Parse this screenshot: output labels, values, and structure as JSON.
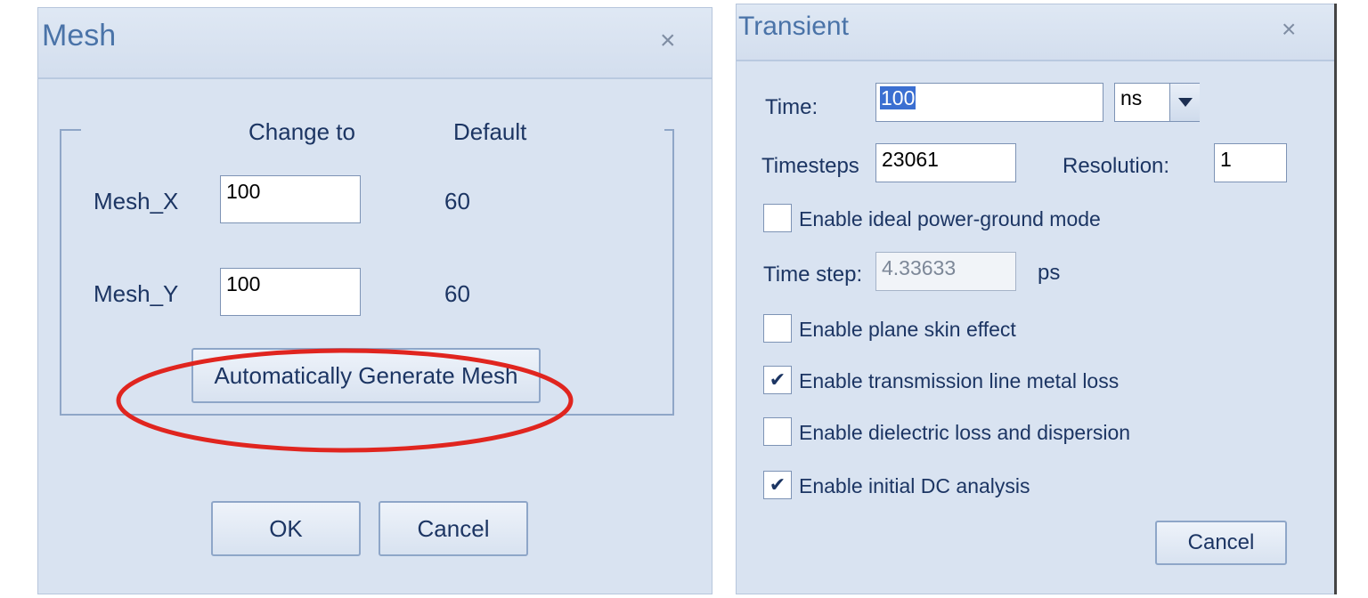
{
  "mesh_dialog": {
    "title": "Mesh",
    "close_glyph": "×",
    "col_change": "Change to",
    "col_default": "Default",
    "rows": [
      {
        "label": "Mesh_X",
        "value": "100",
        "default": "60"
      },
      {
        "label": "Mesh_Y",
        "value": "100",
        "default": "60"
      }
    ],
    "auto_button": "Automatically Generate Mesh",
    "ok_button": "OK",
    "cancel_button": "Cancel",
    "highlight_color": "#e0251f"
  },
  "transient_dialog": {
    "title": "Transient",
    "close_glyph": "×",
    "time_label": "Time:",
    "time_value": "100",
    "time_unit": "ns",
    "timesteps_label": "Timesteps",
    "timesteps_value": "23061",
    "resolution_label": "Resolution:",
    "resolution_value": "1",
    "timestep_label": "Time step:",
    "timestep_value": "4.33633",
    "timestep_unit": "ps",
    "options": [
      {
        "label": "Enable ideal power-ground mode",
        "checked": false
      },
      {
        "label": "Enable plane skin effect",
        "checked": false
      },
      {
        "label": "Enable transmission line metal loss",
        "checked": true
      },
      {
        "label": "Enable dielectric loss and dispersion",
        "checked": false
      },
      {
        "label": "Enable initial DC analysis",
        "checked": true
      }
    ],
    "check_glyph": "✔",
    "cancel_button": "Cancel",
    "selection_color": "#3b6fd1"
  }
}
